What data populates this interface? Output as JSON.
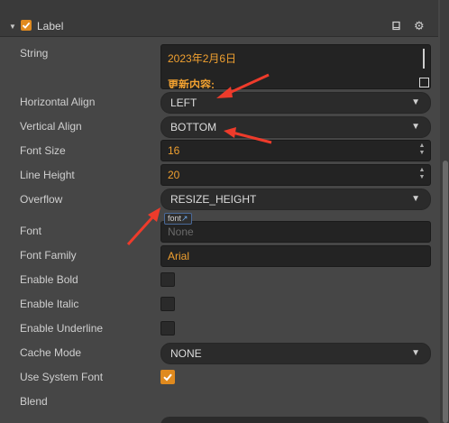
{
  "header": {
    "title": "Label",
    "book_icon": "book-icon",
    "gear_icon": "gear-icon"
  },
  "properties": {
    "string": {
      "label": "String",
      "line1": "2023年2月6日",
      "line2": "更新内容:"
    },
    "horizontal_align": {
      "label": "Horizontal Align",
      "value": "LEFT"
    },
    "vertical_align": {
      "label": "Vertical Align",
      "value": "BOTTOM"
    },
    "font_size": {
      "label": "Font Size",
      "value": "16"
    },
    "line_height": {
      "label": "Line Height",
      "value": "20"
    },
    "overflow": {
      "label": "Overflow",
      "value": "RESIZE_HEIGHT"
    },
    "font": {
      "label": "Font",
      "tag": "font",
      "placeholder": "None"
    },
    "font_family": {
      "label": "Font Family",
      "value": "Arial"
    },
    "enable_bold": {
      "label": "Enable Bold",
      "checked": false
    },
    "enable_italic": {
      "label": "Enable Italic",
      "checked": false
    },
    "enable_underline": {
      "label": "Enable Underline",
      "checked": false
    },
    "cache_mode": {
      "label": "Cache Mode",
      "value": "NONE"
    },
    "use_system_font": {
      "label": "Use System Font",
      "checked": true
    },
    "blend": {
      "label": "Blend"
    }
  },
  "colors": {
    "accent": "#e08a1e",
    "value_text": "#f0a030",
    "annotation_arrow": "#ee3b2b"
  }
}
